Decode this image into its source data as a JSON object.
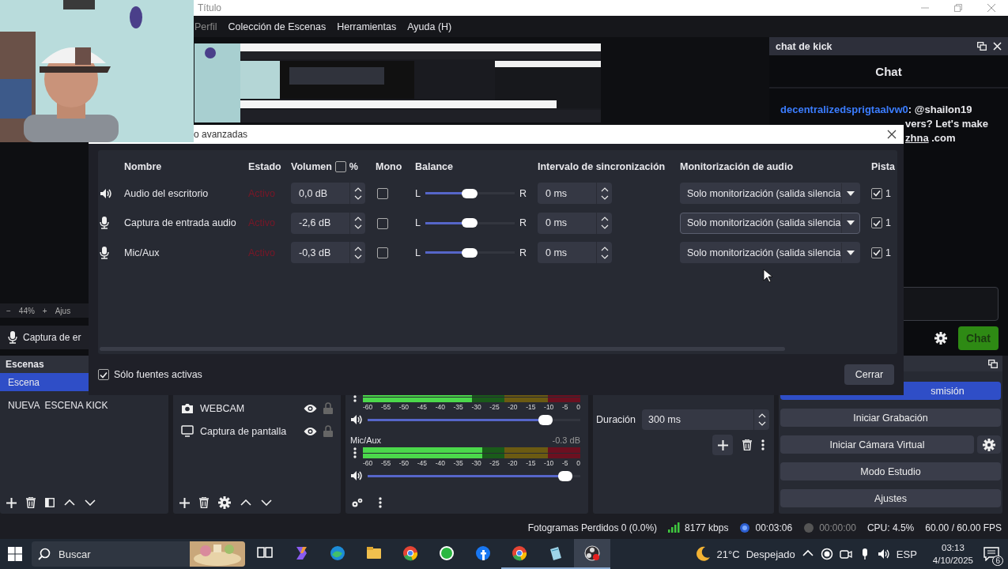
{
  "window": {
    "title": "Título"
  },
  "menu": [
    "Perfil",
    "Colección de Escenas",
    "Herramientas",
    "Ayuda (H)"
  ],
  "preview_controls": {
    "zoom_out": "−",
    "zoom": "44%",
    "zoom_in": "+",
    "adjust": "Ajus"
  },
  "source_strip": {
    "name": "Captura de er"
  },
  "chat_dock": {
    "title": "chat de kick",
    "header": "Chat",
    "message": {
      "user": "decentralizedsprigtaalvw0",
      "text": ": @shailon19",
      "line_2": "vers? Let's make",
      "link": "zhna",
      "line_3_rest": " .com"
    },
    "send_button": "Chat"
  },
  "dialog": {
    "title": "o avanzadas",
    "columns": [
      "Nombre",
      "Estado",
      "Volumen",
      "Mono",
      "Balance",
      "Intervalo de sincronización",
      "Monitorización de audio",
      "Pista"
    ],
    "volume_percent": {
      "label": "%",
      "checked": false
    },
    "rows": [
      {
        "kind": "speaker",
        "name": "Audio del escritorio",
        "status": "Activo",
        "volume": "0,0 dB",
        "mono": false,
        "left": "L",
        "balance": {
          "level": 0.5
        },
        "right": "R",
        "sync": "0 ms",
        "monitoring": "Solo monitorización (salida silencia",
        "focused": false,
        "track_checked": true,
        "track": "1"
      },
      {
        "kind": "mic",
        "name": "Captura de entrada audio",
        "status": "Activo",
        "volume": "-2,6 dB",
        "mono": false,
        "left": "L",
        "balance": {
          "level": 0.5
        },
        "right": "R",
        "sync": "0 ms",
        "monitoring": "Solo monitorización (salida silencia",
        "focused": true,
        "track_checked": true,
        "track": "1"
      },
      {
        "kind": "mic",
        "name": "Mic/Aux",
        "status": "Activo",
        "volume": "-0,3 dB",
        "mono": false,
        "left": "L",
        "balance": {
          "level": 0.5
        },
        "right": "R",
        "sync": "0 ms",
        "monitoring": "Solo monitorización (salida silencia",
        "focused": false,
        "track_checked": true,
        "track": "1"
      }
    ],
    "active_only": {
      "label": "Sólo fuentes activas",
      "checked": true
    },
    "close_button": "Cerrar"
  },
  "scenes": {
    "title": "Escenas",
    "items": [
      {
        "label": "Escena",
        "selected": true
      },
      {
        "label": "NUEVA  ESCENA KICK",
        "selected": false
      }
    ]
  },
  "sources": [
    {
      "kind": "camera",
      "name": "WEBCAM",
      "visible": true,
      "locked": false
    },
    {
      "kind": "display",
      "name": "Captura de pantalla",
      "visible": true,
      "locked": false
    }
  ],
  "mixer": [
    {
      "meter": {
        "level": 0.5
      },
      "scale": [
        "-60",
        "-55",
        "-50",
        "-45",
        "-40",
        "-35",
        "-30",
        "-25",
        "-20",
        "-15",
        "-10",
        "-5",
        "0"
      ],
      "volume": {
        "level": 0.86
      }
    },
    {
      "name": "Mic/Aux",
      "reading": "-0.3 dB",
      "meter": {
        "level": 0.55
      },
      "scale": [
        "-60",
        "-55",
        "-50",
        "-45",
        "-40",
        "-35",
        "-30",
        "-25",
        "-20",
        "-15",
        "-10",
        "-5",
        "0"
      ],
      "volume": {
        "level": 0.96
      }
    }
  ],
  "transition": {
    "label": "Duración",
    "duration": "300 ms"
  },
  "controls": [
    {
      "label": "smisión",
      "on": true
    },
    {
      "label": "Iniciar Grabación",
      "on": false
    },
    {
      "label": "Iniciar Cámara Virtual",
      "on": false,
      "kind": "with-settings"
    },
    {
      "label": "Modo Estudio",
      "on": false
    },
    {
      "label": "Ajustes",
      "on": false
    }
  ],
  "status_bar": {
    "dropped": "Fotogramas Perdidos 0 (0.0%)",
    "bitrate": "8177 kbps",
    "stream_time": "00:03:06",
    "streaming": true,
    "record_time": "00:00:00",
    "recording": false,
    "cpu": "CPU: 4.5%",
    "fps": "60.00 / 60.00 FPS"
  },
  "taskbar": {
    "search_placeholder": "Buscar",
    "apps": [
      {
        "kind": "task-view",
        "running": false,
        "active": false
      },
      {
        "kind": "copilot",
        "running": false,
        "active": false
      },
      {
        "kind": "edge",
        "running": false,
        "active": false
      },
      {
        "kind": "folder",
        "running": false,
        "active": false
      },
      {
        "kind": "chrome",
        "running": false,
        "active": false
      },
      {
        "kind": "whatsapp",
        "running": false,
        "active": false
      },
      {
        "kind": "facebook",
        "running": false,
        "active": false
      },
      {
        "kind": "chrome",
        "running": true,
        "active": false
      },
      {
        "kind": "notepad",
        "running": true,
        "active": false
      },
      {
        "kind": "obs",
        "running": true,
        "active": true
      }
    ],
    "temperature": "21°C",
    "weather": "Despejado",
    "language": "ESP",
    "time": "03:13",
    "date": "4/10/2025",
    "notifications": "6"
  }
}
